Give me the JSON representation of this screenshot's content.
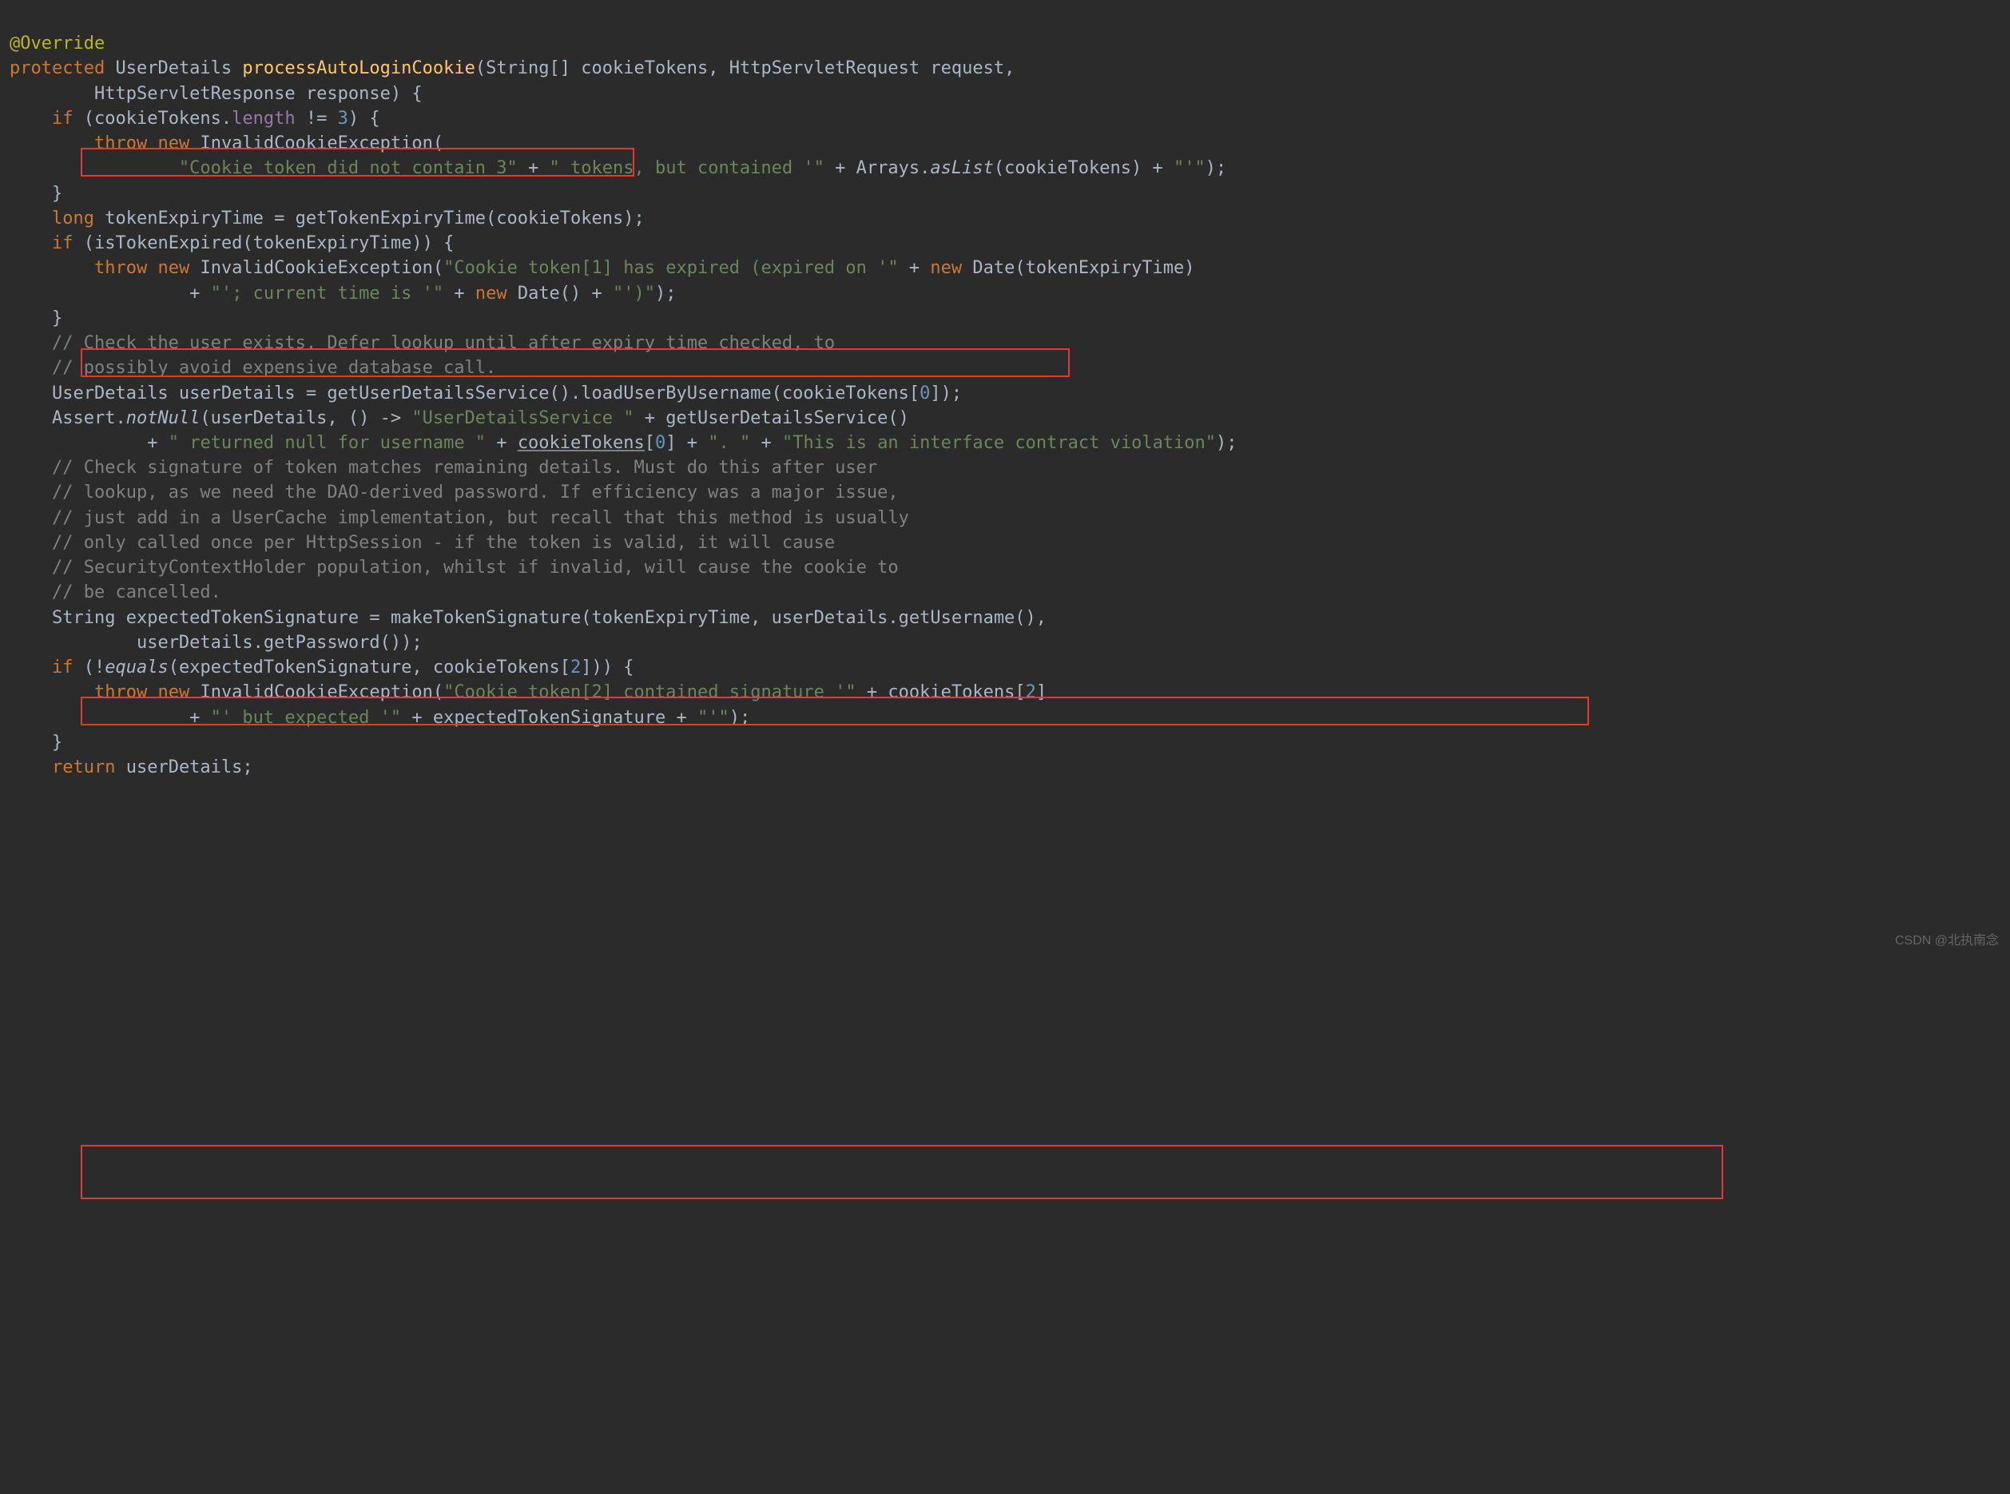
{
  "t": {
    "ann": "@Override",
    "protected": "protected",
    "UserDetails": "UserDetails",
    "method": "processAutoLoginCookie",
    "p1o": "(String[] cookieTokens, HttpServletRequest request,",
    "p2": "HttpServletResponse response) {",
    "if1a": "if",
    "if1b": " (cookieTokens.",
    "length": "length",
    "if1c": " != ",
    "three": "3",
    "if1d": ") {",
    "throw": "throw",
    "new": "new",
    "ice": " InvalidCookieException(",
    "s1": "\"Cookie token did not contain 3\"",
    "plus": " + ",
    "s2": "\" tokens, but contained '\"",
    "arr": " + Arrays.",
    "asList": "asList",
    "arr2": "(cookieTokens) + ",
    "s3": "\"'\"",
    "rp": ");",
    "cb": "}",
    "long": "long",
    "lr": " tokenExpiryTime = getTokenExpiryTime(cookieTokens);",
    "if2": " (isTokenExpired(tokenExpiryTime)) {",
    "ice2": " InvalidCookieException(",
    "s4": "\"Cookie token[1] has expired (expired on '\"",
    "newDate": " Date(tokenExpiryTime)",
    "s5": "\"'; current time is '\"",
    "nd2": " Date() + ",
    "s6": "\"')\"",
    "c1": "// Check the user exists. Defer lookup until after expiry time checked, to",
    "c2": "// possibly avoid expensive database call.",
    "udLine": " userDetails = getUserDetailsService().loadUserByUsername(cookieTokens[",
    "zero": "0",
    "brk": "]);",
    "assertA": "Assert.",
    "notNull": "notNull",
    "assertB": "(userDetails, () -> ",
    "s7": "\"UserDetailsService \"",
    "getUDSvc": " + getUserDetailsService()",
    "s8": "\" returned null for username \"",
    "ctu": "cookieTokens",
    "brk2a": "[",
    "brk2b": "] + ",
    "s9": "\". \"",
    "s10": "\"This is an interface contract violation\"",
    "c3": "// Check signature of token matches remaining details. Must do this after user",
    "c4": "// lookup, as we need the DAO-derived password. If efficiency was a major issue,",
    "c5": "// just add in a UserCache implementation, but recall that this method is usually",
    "c6": "// only called once per HttpSession - if the token is valid, it will cause",
    "c7": "// SecurityContextHolder population, whilst if invalid, will cause the cookie to",
    "c8": "// be cancelled.",
    "StringT": "String",
    "expSig": " expectedTokenSignature = makeTokenSignature(tokenExpiryTime, userDetails.getUsername(),",
    "getPw": "userDetails.getPassword());",
    "if3a": " (!",
    "equals": "equals",
    "if3b": "(expectedTokenSignature, cookieTokens[",
    "two": "2",
    "if3c": "])) {",
    "s11": "\"Cookie token[2] contained signature '\"",
    "ctk2": " + cookieTokens[",
    "brk3": "]",
    "s12": "\"' but expected '\"",
    "expSigPlus": " + expectedTokenSignature + ",
    "s13": "\"'\"",
    "return": "return",
    "retUD": " userDetails;",
    "wm": "CSDN @北执南念"
  }
}
